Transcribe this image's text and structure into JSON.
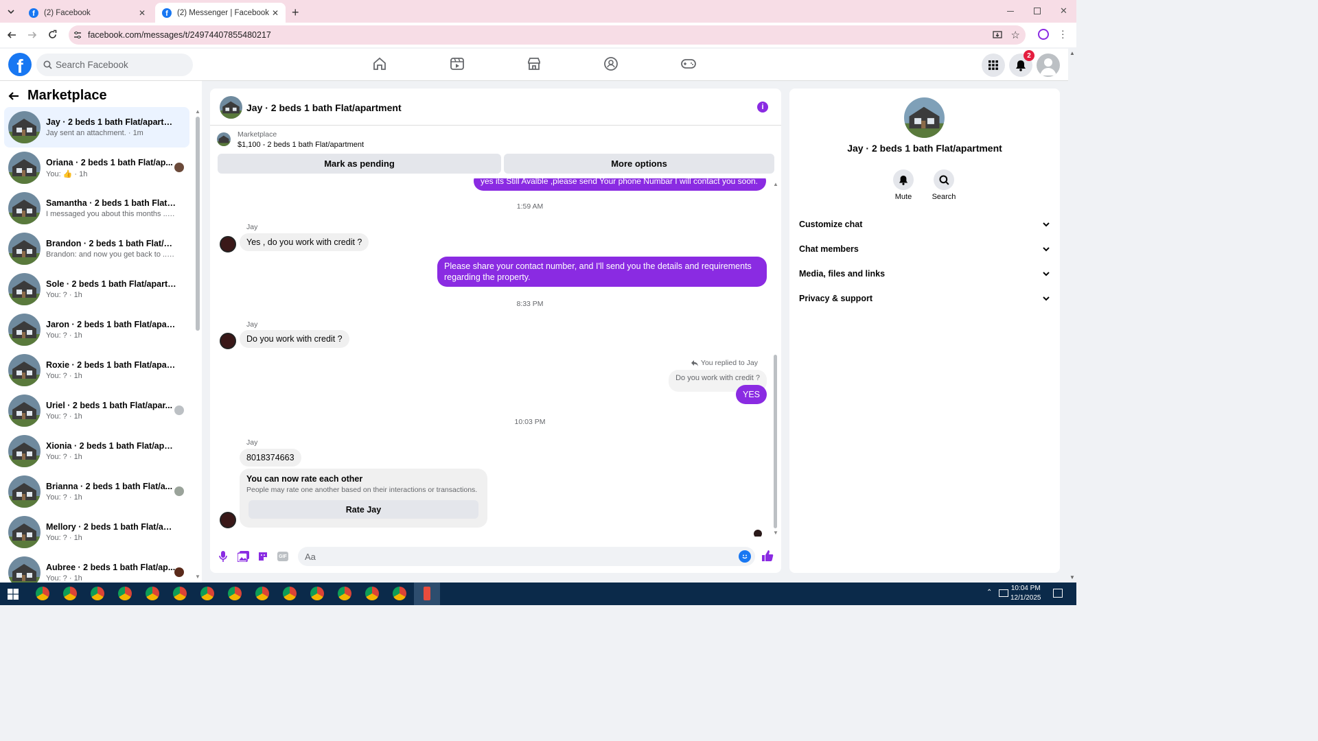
{
  "browser": {
    "tabs": [
      {
        "label": "(2) Facebook",
        "active": false
      },
      {
        "label": "(2) Messenger | Facebook",
        "active": true
      }
    ],
    "url": "facebook.com/messages/t/24974407855480217"
  },
  "fb": {
    "search_placeholder": "Search Facebook",
    "notif_count": "2"
  },
  "sidebar": {
    "title": "Marketplace",
    "conversations": [
      {
        "title": "Jay · 2 beds 1 bath Flat/apartment",
        "sub": "Jay sent an attachment. · 1m",
        "active": true
      },
      {
        "title": "Oriana · 2 beds 1 bath Flat/ap...",
        "sub": "You: 👍 · 1h"
      },
      {
        "title": "Samantha · 2 beds 1 bath Flat/a...",
        "sub": "I messaged you about this months ... · 1h"
      },
      {
        "title": "Brandon · 2 beds 1 bath Flat/apa...",
        "sub": "Brandon: and now you get back to ... · 1h"
      },
      {
        "title": "Sole · 2 beds 1 bath Flat/apartm...",
        "sub": "You: ? · 1h"
      },
      {
        "title": "Jaron · 2 beds 1 bath Flat/apart...",
        "sub": "You: ? · 1h"
      },
      {
        "title": "Roxie · 2 beds 1 bath Flat/apart...",
        "sub": "You: ? · 1h"
      },
      {
        "title": "Uriel · 2 beds 1 bath Flat/apar...",
        "sub": "You: ? · 1h"
      },
      {
        "title": "Xionia · 2 beds 1 bath Flat/apart...",
        "sub": "You: ? · 1h"
      },
      {
        "title": "Brianna · 2 beds 1 bath Flat/a...",
        "sub": "You: ? · 1h"
      },
      {
        "title": "Mellory · 2 beds 1 bath Flat/apar...",
        "sub": "You: ? · 1h"
      },
      {
        "title": "Aubree · 2 beds 1 bath Flat/ap...",
        "sub": "You: ? · 1h"
      }
    ]
  },
  "chat": {
    "title": "Jay · 2 beds 1 bath Flat/apartment",
    "marketplace_label": "Marketplace",
    "listing": "$1,100 - 2 beds 1 bath Flat/apartment",
    "mark_pending": "Mark as pending",
    "more_options": "More options",
    "msg_top_partial": "yes its Still Avalble ,please send Your phone Numbar I will contact you soon.",
    "ts1": "1:59 AM",
    "sender1": "Jay",
    "msg1": "Yes , do you work with credit ?",
    "msg2": "Please share your contact number, and I'll send you the details and requirements regarding the property.",
    "ts2": "8:33 PM",
    "sender2": "Jay",
    "msg3": "Do you work with credit ?",
    "reply_note": "You replied to Jay",
    "reply_quote": "Do you work with credit ?",
    "msg4": "YES",
    "ts3": "10:03 PM",
    "sender3": "Jay",
    "msg5": "8018374663",
    "rate_title": "You can now rate each other",
    "rate_desc": "People may rate one another based on their interactions or transactions.",
    "rate_button": "Rate Jay",
    "composer_placeholder": "Aa"
  },
  "details": {
    "title": "Jay · 2 beds 1 bath Flat/apartment",
    "mute": "Mute",
    "search": "Search",
    "rows": [
      "Customize chat",
      "Chat members",
      "Media, files and links",
      "Privacy & support"
    ]
  },
  "taskbar": {
    "time": "10:04 PM",
    "date": "12/1/2025"
  },
  "colors": {
    "accent": "#8a2be2",
    "fb_blue": "#1877f2"
  }
}
